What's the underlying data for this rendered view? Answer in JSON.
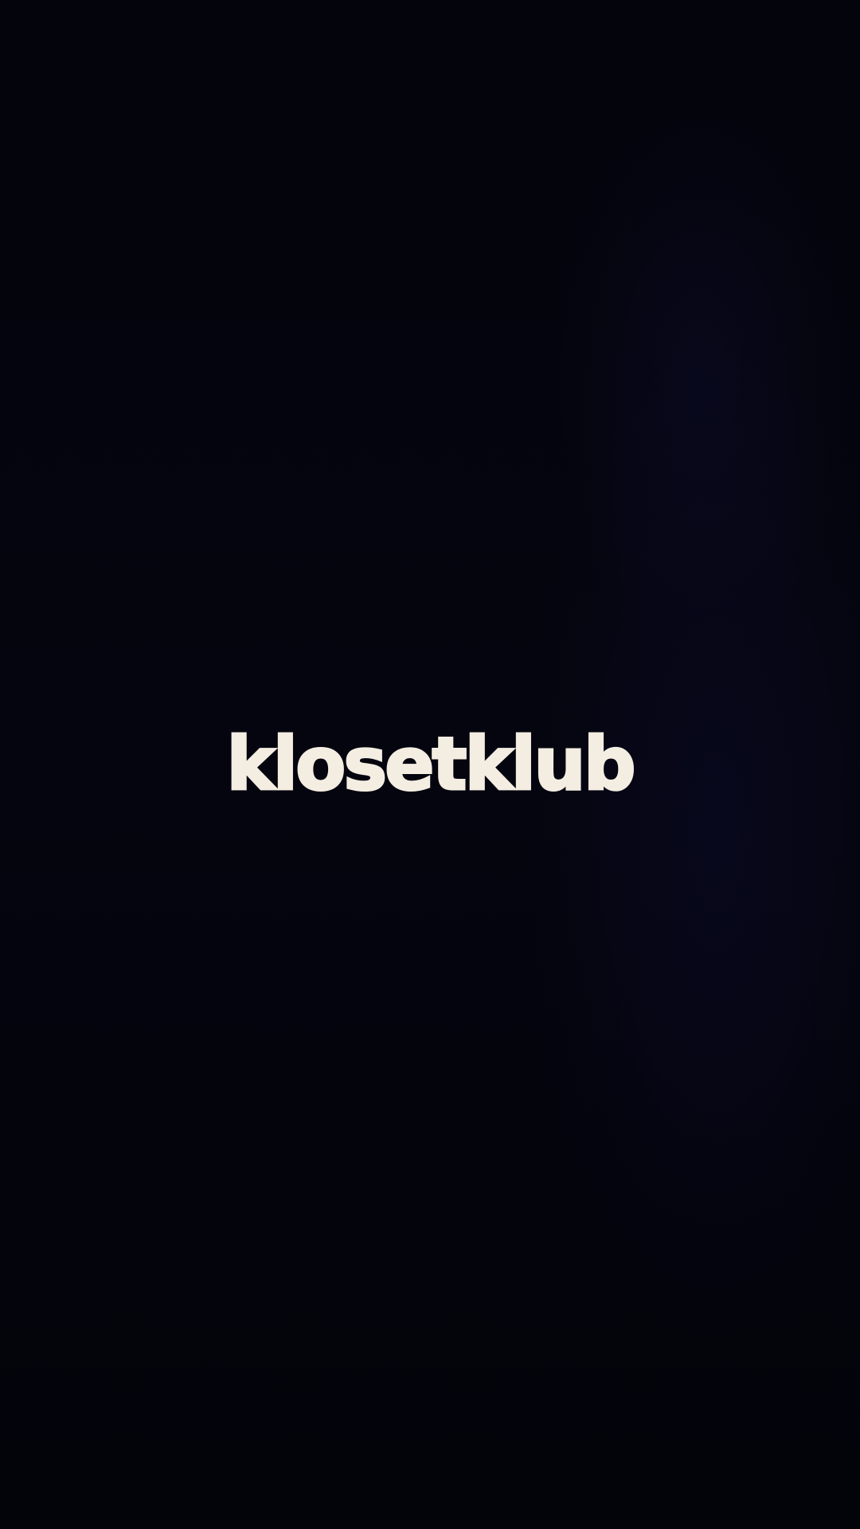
{
  "splash": {
    "brand_name": "klosetklub",
    "background_color": "#05050d",
    "logo_color": "#f4ede2"
  }
}
